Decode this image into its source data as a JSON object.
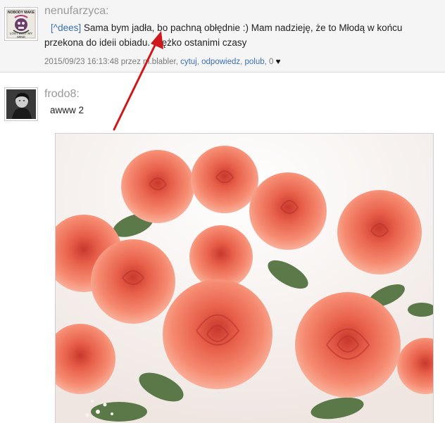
{
  "comments": [
    {
      "author": "nenufarzyca:",
      "avatar_text": [
        "NOBODY MAKE",
        "LOST LUST MY",
        "MIND"
      ],
      "reply_tag": "[^dees]",
      "text": "Sama bym jadła, bo pachną obłędnie :) Mam nadzieję, że to Młodą w końcu przekona do ideii obiadu. Ciężko ostanimi czasy",
      "meta": {
        "timestamp": "2015/09/23 16:13:48 przez m.blabler,",
        "actions": [
          "cytuj",
          "odpowiedz",
          "polub"
        ],
        "likes": "0",
        "heart": "♥"
      }
    },
    {
      "author": "frodo8:",
      "text": "awww 2",
      "image": {
        "subject": "bouquet of coral roses",
        "colors": [
          "#f07a62",
          "#e85a47",
          "#f4a08b",
          "#4e6a3a"
        ]
      }
    }
  ],
  "annotation": {
    "type": "red arrow",
    "color": "#d0181c"
  }
}
